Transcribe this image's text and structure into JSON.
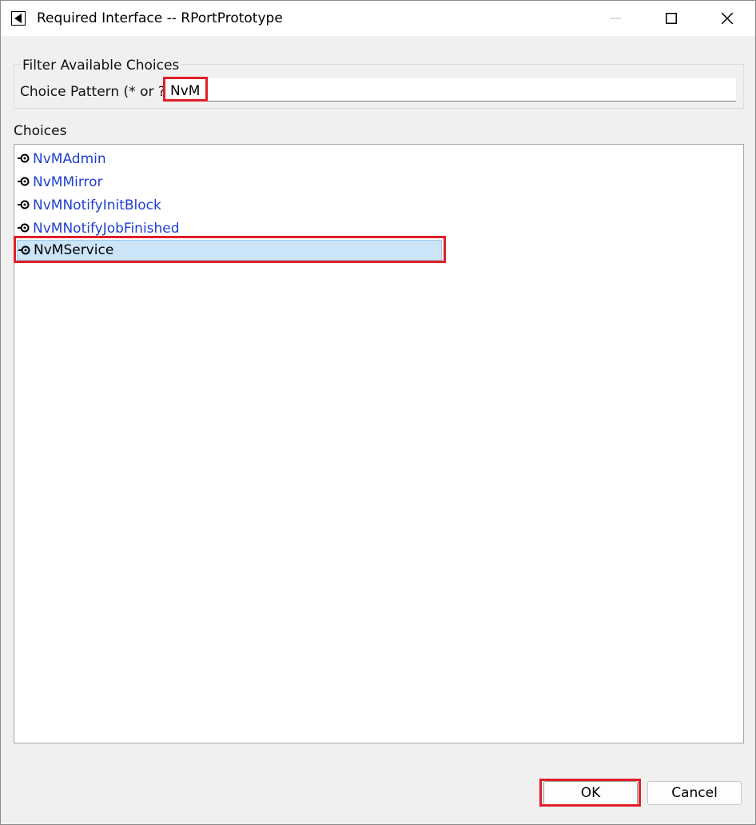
{
  "window": {
    "title": "Required Interface -- RPortPrototype",
    "icon": "app-back-arrow-icon",
    "controls": [
      "minimize-icon",
      "maximize-icon",
      "close-icon"
    ]
  },
  "filter": {
    "group_label": "Filter Available Choices",
    "pattern_label": "Choice Pattern (* or ?)",
    "pattern_value": "NvM"
  },
  "choices": {
    "label": "Choices",
    "item_icon": "port-interface-icon",
    "items": [
      {
        "label": "NvMAdmin",
        "selected": false
      },
      {
        "label": "NvMMirror",
        "selected": false
      },
      {
        "label": "NvMNotifyInitBlock",
        "selected": false
      },
      {
        "label": "NvMNotifyJobFinished",
        "selected": false
      },
      {
        "label": "NvMService",
        "selected": true
      }
    ]
  },
  "buttons": {
    "ok": "OK",
    "cancel": "Cancel"
  },
  "colors": {
    "highlight_box": "#e0202a",
    "link_text": "#1f3fd0",
    "selection_bg": "#cce4f7"
  }
}
